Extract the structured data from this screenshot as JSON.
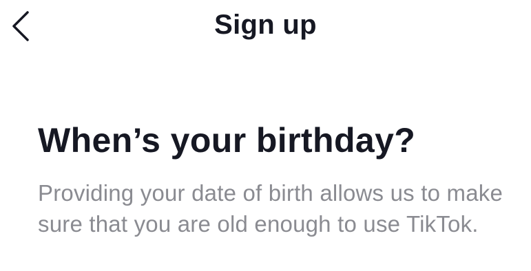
{
  "header": {
    "back_icon": "chevron-left-icon",
    "title": "Sign up"
  },
  "main": {
    "heading": "When’s your birthday?",
    "description": "Providing your date of birth allows us to make sure that you are old enough to use TikTok."
  },
  "colors": {
    "text_primary": "#161823",
    "text_secondary": "#8a8b91",
    "background": "#ffffff"
  }
}
